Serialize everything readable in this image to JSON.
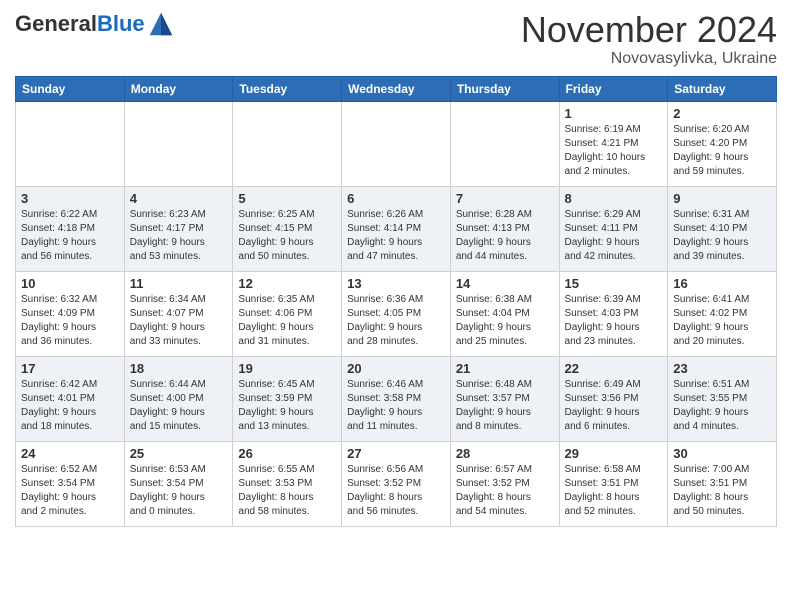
{
  "header": {
    "logo_general": "General",
    "logo_blue": "Blue",
    "month": "November 2024",
    "location": "Novovasylivka, Ukraine"
  },
  "weekdays": [
    "Sunday",
    "Monday",
    "Tuesday",
    "Wednesday",
    "Thursday",
    "Friday",
    "Saturday"
  ],
  "weeks": [
    [
      {
        "day": "",
        "info": ""
      },
      {
        "day": "",
        "info": ""
      },
      {
        "day": "",
        "info": ""
      },
      {
        "day": "",
        "info": ""
      },
      {
        "day": "",
        "info": ""
      },
      {
        "day": "1",
        "info": "Sunrise: 6:19 AM\nSunset: 4:21 PM\nDaylight: 10 hours\nand 2 minutes."
      },
      {
        "day": "2",
        "info": "Sunrise: 6:20 AM\nSunset: 4:20 PM\nDaylight: 9 hours\nand 59 minutes."
      }
    ],
    [
      {
        "day": "3",
        "info": "Sunrise: 6:22 AM\nSunset: 4:18 PM\nDaylight: 9 hours\nand 56 minutes."
      },
      {
        "day": "4",
        "info": "Sunrise: 6:23 AM\nSunset: 4:17 PM\nDaylight: 9 hours\nand 53 minutes."
      },
      {
        "day": "5",
        "info": "Sunrise: 6:25 AM\nSunset: 4:15 PM\nDaylight: 9 hours\nand 50 minutes."
      },
      {
        "day": "6",
        "info": "Sunrise: 6:26 AM\nSunset: 4:14 PM\nDaylight: 9 hours\nand 47 minutes."
      },
      {
        "day": "7",
        "info": "Sunrise: 6:28 AM\nSunset: 4:13 PM\nDaylight: 9 hours\nand 44 minutes."
      },
      {
        "day": "8",
        "info": "Sunrise: 6:29 AM\nSunset: 4:11 PM\nDaylight: 9 hours\nand 42 minutes."
      },
      {
        "day": "9",
        "info": "Sunrise: 6:31 AM\nSunset: 4:10 PM\nDaylight: 9 hours\nand 39 minutes."
      }
    ],
    [
      {
        "day": "10",
        "info": "Sunrise: 6:32 AM\nSunset: 4:09 PM\nDaylight: 9 hours\nand 36 minutes."
      },
      {
        "day": "11",
        "info": "Sunrise: 6:34 AM\nSunset: 4:07 PM\nDaylight: 9 hours\nand 33 minutes."
      },
      {
        "day": "12",
        "info": "Sunrise: 6:35 AM\nSunset: 4:06 PM\nDaylight: 9 hours\nand 31 minutes."
      },
      {
        "day": "13",
        "info": "Sunrise: 6:36 AM\nSunset: 4:05 PM\nDaylight: 9 hours\nand 28 minutes."
      },
      {
        "day": "14",
        "info": "Sunrise: 6:38 AM\nSunset: 4:04 PM\nDaylight: 9 hours\nand 25 minutes."
      },
      {
        "day": "15",
        "info": "Sunrise: 6:39 AM\nSunset: 4:03 PM\nDaylight: 9 hours\nand 23 minutes."
      },
      {
        "day": "16",
        "info": "Sunrise: 6:41 AM\nSunset: 4:02 PM\nDaylight: 9 hours\nand 20 minutes."
      }
    ],
    [
      {
        "day": "17",
        "info": "Sunrise: 6:42 AM\nSunset: 4:01 PM\nDaylight: 9 hours\nand 18 minutes."
      },
      {
        "day": "18",
        "info": "Sunrise: 6:44 AM\nSunset: 4:00 PM\nDaylight: 9 hours\nand 15 minutes."
      },
      {
        "day": "19",
        "info": "Sunrise: 6:45 AM\nSunset: 3:59 PM\nDaylight: 9 hours\nand 13 minutes."
      },
      {
        "day": "20",
        "info": "Sunrise: 6:46 AM\nSunset: 3:58 PM\nDaylight: 9 hours\nand 11 minutes."
      },
      {
        "day": "21",
        "info": "Sunrise: 6:48 AM\nSunset: 3:57 PM\nDaylight: 9 hours\nand 8 minutes."
      },
      {
        "day": "22",
        "info": "Sunrise: 6:49 AM\nSunset: 3:56 PM\nDaylight: 9 hours\nand 6 minutes."
      },
      {
        "day": "23",
        "info": "Sunrise: 6:51 AM\nSunset: 3:55 PM\nDaylight: 9 hours\nand 4 minutes."
      }
    ],
    [
      {
        "day": "24",
        "info": "Sunrise: 6:52 AM\nSunset: 3:54 PM\nDaylight: 9 hours\nand 2 minutes."
      },
      {
        "day": "25",
        "info": "Sunrise: 6:53 AM\nSunset: 3:54 PM\nDaylight: 9 hours\nand 0 minutes."
      },
      {
        "day": "26",
        "info": "Sunrise: 6:55 AM\nSunset: 3:53 PM\nDaylight: 8 hours\nand 58 minutes."
      },
      {
        "day": "27",
        "info": "Sunrise: 6:56 AM\nSunset: 3:52 PM\nDaylight: 8 hours\nand 56 minutes."
      },
      {
        "day": "28",
        "info": "Sunrise: 6:57 AM\nSunset: 3:52 PM\nDaylight: 8 hours\nand 54 minutes."
      },
      {
        "day": "29",
        "info": "Sunrise: 6:58 AM\nSunset: 3:51 PM\nDaylight: 8 hours\nand 52 minutes."
      },
      {
        "day": "30",
        "info": "Sunrise: 7:00 AM\nSunset: 3:51 PM\nDaylight: 8 hours\nand 50 minutes."
      }
    ]
  ]
}
